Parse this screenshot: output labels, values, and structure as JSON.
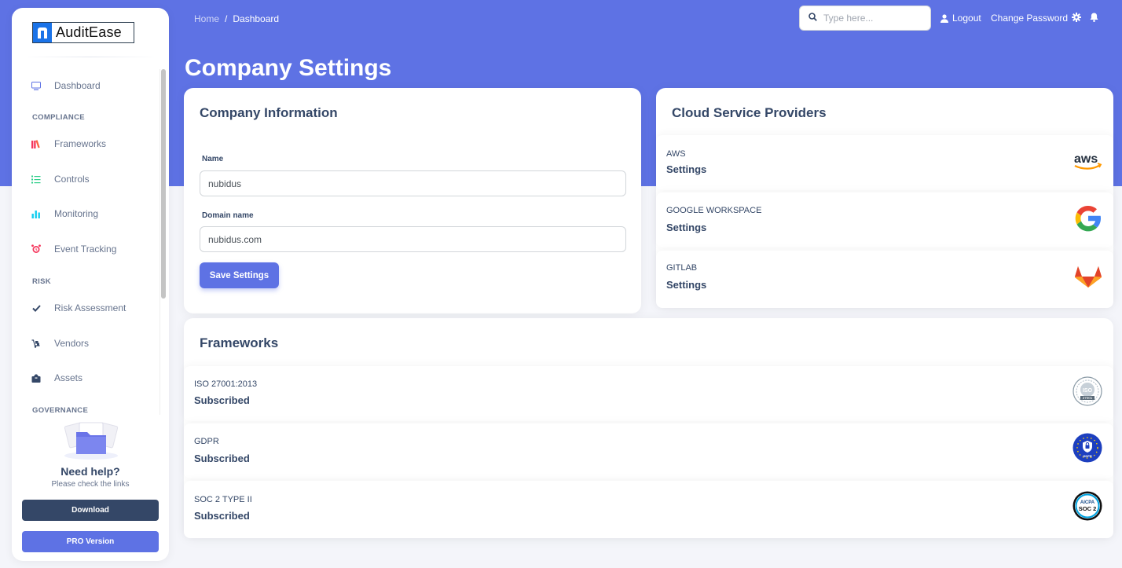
{
  "brand": {
    "name": "AuditEase",
    "accent": "#5e72e4",
    "dark": "#344767"
  },
  "breadcrumb": {
    "home": "Home",
    "separator": "/",
    "current": "Dashboard"
  },
  "search": {
    "placeholder": "Type here..."
  },
  "topnav": {
    "logout": "Logout",
    "change_password": "Change Password",
    "settings_icon": "gear-icon",
    "notifications_icon": "bell-icon"
  },
  "page": {
    "title": "Company Settings"
  },
  "sidebar": {
    "dashboard": "Dashboard",
    "compliance_header": "COMPLIANCE",
    "frameworks": "Frameworks",
    "controls": "Controls",
    "monitoring": "Monitoring",
    "event_tracking": "Event Tracking",
    "risk_header": "RISK",
    "risk_assessment": "Risk Assessment",
    "vendors": "Vendors",
    "assets": "Assets",
    "governance_header": "GOVERNANCE"
  },
  "help": {
    "title": "Need help?",
    "subtitle": "Please check the links",
    "download": "Download",
    "pro": "PRO Version"
  },
  "company": {
    "title": "Company Information",
    "name_label": "Name",
    "name_value": "nubidus",
    "domain_label": "Domain name",
    "domain_value": "nubidus.com",
    "save": "Save Settings"
  },
  "cloud": {
    "title": "Cloud Service Providers",
    "providers": [
      {
        "name": "AWS",
        "action": "Settings",
        "icon": "aws-logo"
      },
      {
        "name": "GOOGLE WORKSPACE",
        "action": "Settings",
        "icon": "google-logo"
      },
      {
        "name": "GITLAB",
        "action": "Settings",
        "icon": "gitlab-logo"
      }
    ]
  },
  "frameworks": {
    "title": "Frameworks",
    "items": [
      {
        "name": "ISO 27001:2013",
        "status": "Subscribed",
        "icon": "iso-badge",
        "badge_text": "27001"
      },
      {
        "name": "GDPR",
        "status": "Subscribed",
        "icon": "gdpr-badge",
        "badge_text": "GDPR"
      },
      {
        "name": "SOC 2 TYPE II",
        "status": "Subscribed",
        "icon": "soc2-badge",
        "badge_text": "SOC 2",
        "badge_top": "AICPA"
      }
    ]
  }
}
